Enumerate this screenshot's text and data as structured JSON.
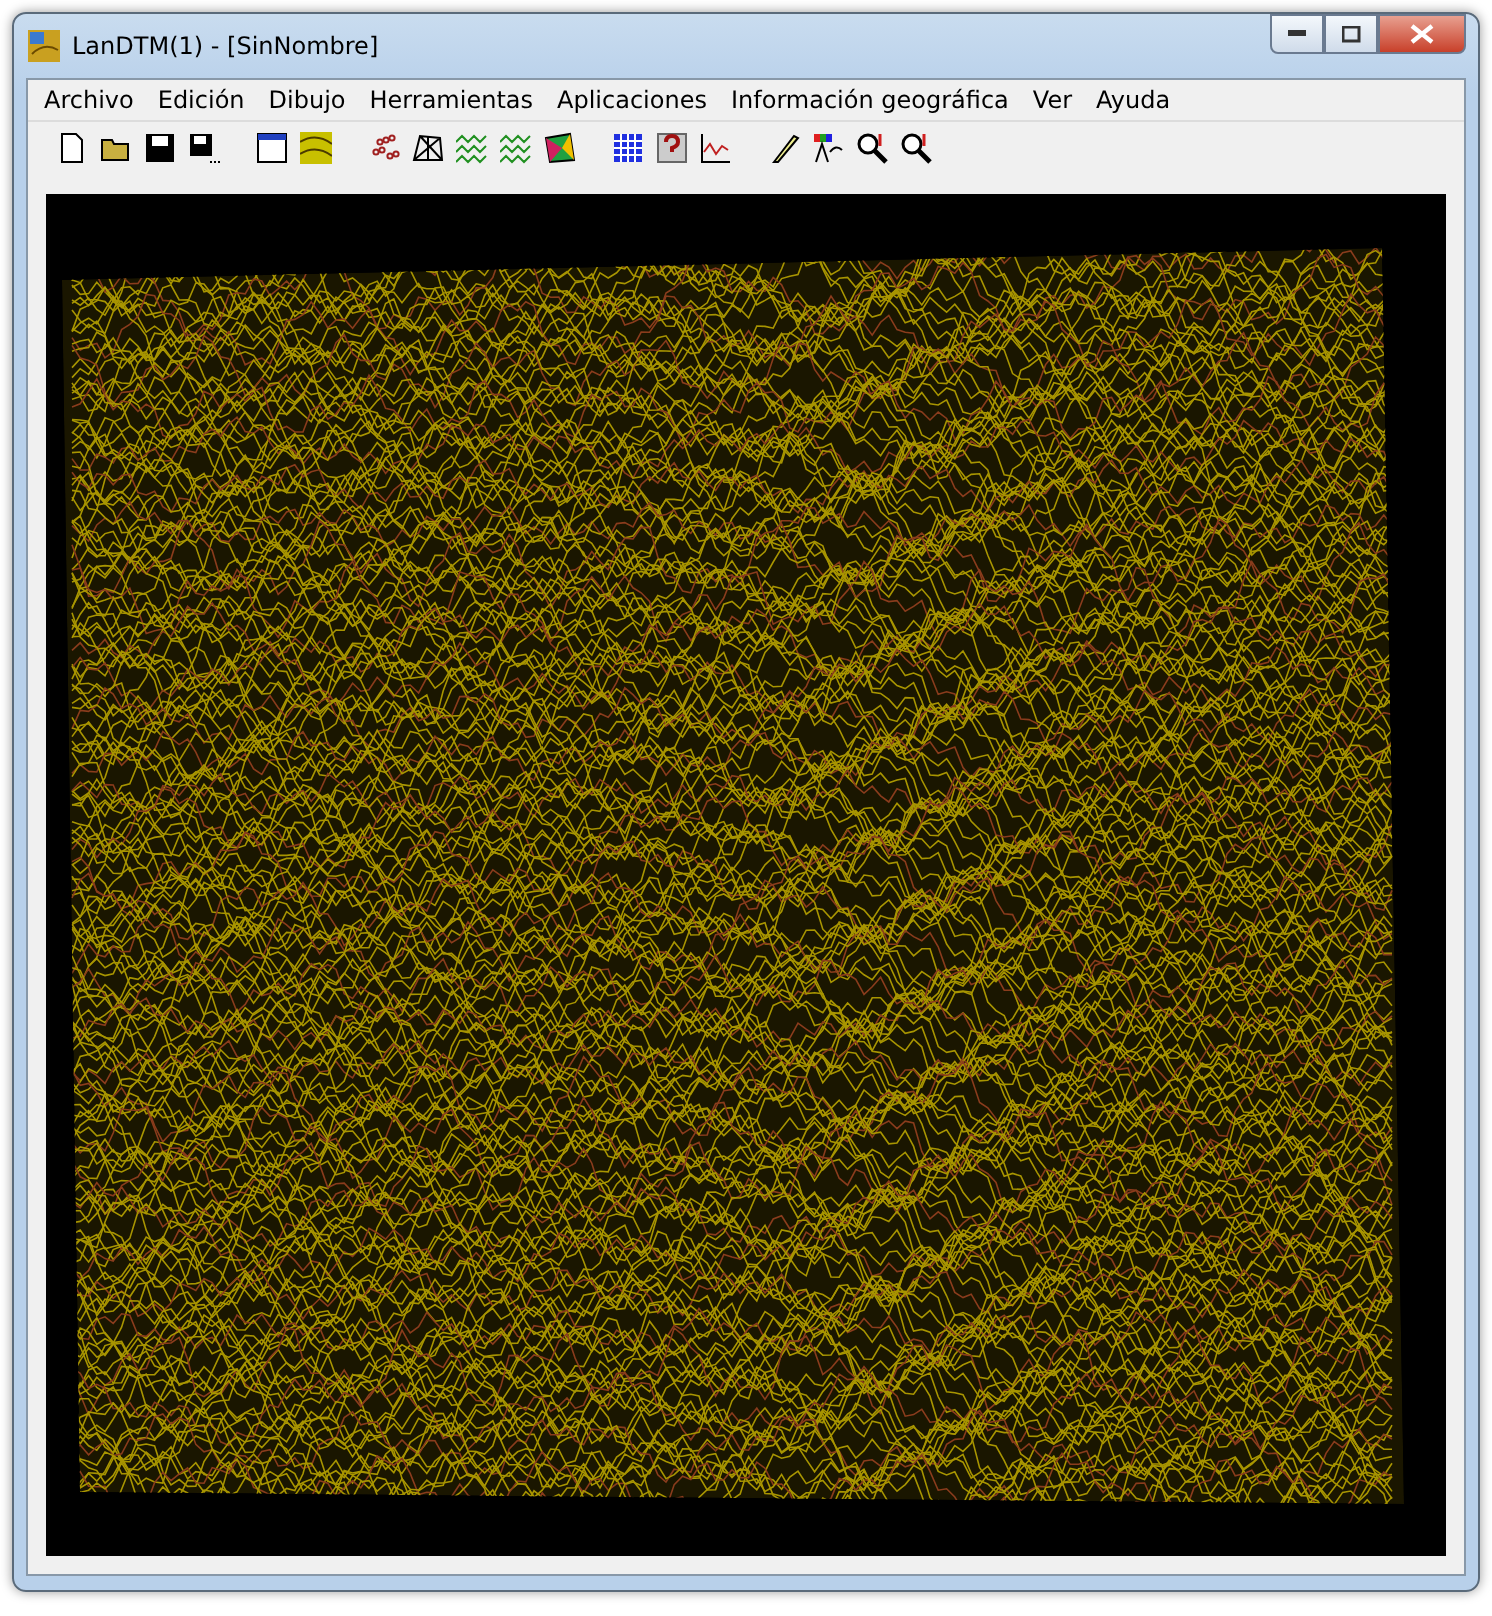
{
  "window": {
    "title": "LanDTM(1) - [SinNombre]"
  },
  "menu": [
    "Archivo",
    "Edición",
    "Dibujo",
    "Herramientas",
    "Aplicaciones",
    "Información geográfica",
    "Ver",
    "Ayuda"
  ]
}
